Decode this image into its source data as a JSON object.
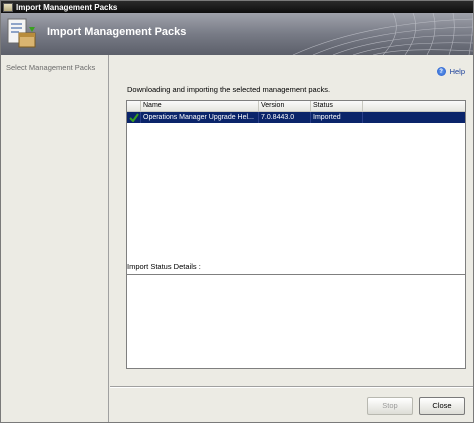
{
  "window": {
    "title": "Import Management Packs"
  },
  "banner": {
    "title": "Import Management Packs"
  },
  "sidebar": {
    "steps": [
      {
        "label": "Select Management Packs"
      }
    ]
  },
  "main": {
    "help_label": "Help",
    "description": "Downloading and importing the selected management packs.",
    "list": {
      "columns": [
        "",
        "Name",
        "Version",
        "Status",
        ""
      ],
      "rows": [
        {
          "checked": true,
          "name": "Operations Manager Upgrade Hel...",
          "version": "7.0.8443.0",
          "status": "Imported"
        }
      ]
    },
    "status_details_label": "Import Status Details :",
    "status_details_text": ""
  },
  "buttons": {
    "stop_label": "Stop",
    "close_label": "Close"
  },
  "colors": {
    "selection": "#0a246a",
    "banner_top": "#9fa2ab",
    "banner_bottom": "#5c5f6a",
    "check": "#3aa020"
  },
  "icons": {
    "banner": "import-management-pack-icon",
    "help": "help-icon",
    "row_status": "checkmark-icon"
  }
}
